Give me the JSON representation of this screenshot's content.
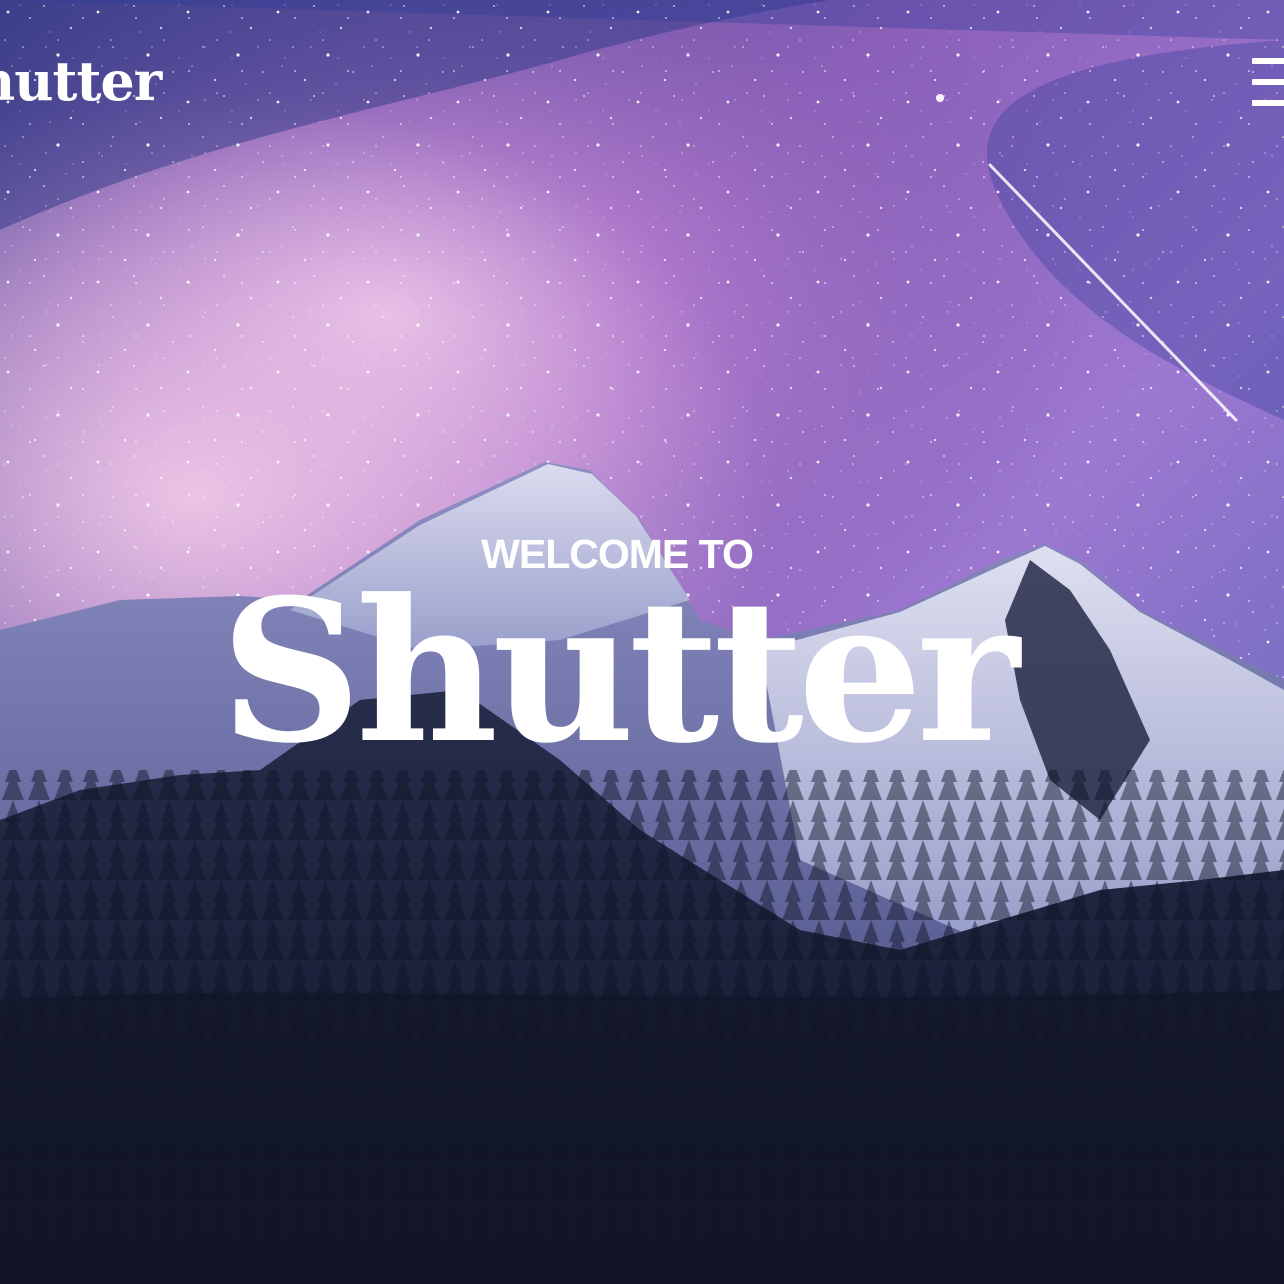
{
  "header": {
    "logo_text": "Shutter",
    "menu_icon": "hamburger-menu-icon"
  },
  "hero": {
    "eyebrow": "WELCOME TO",
    "title": "Shutter",
    "background": "night-sky-mountains-photo"
  },
  "colors": {
    "text": "#ffffff",
    "sky_top": "#2b3f8c",
    "sky_glow": "#c98ad6",
    "snow": "#d8dcef",
    "forest": "#161b30"
  }
}
